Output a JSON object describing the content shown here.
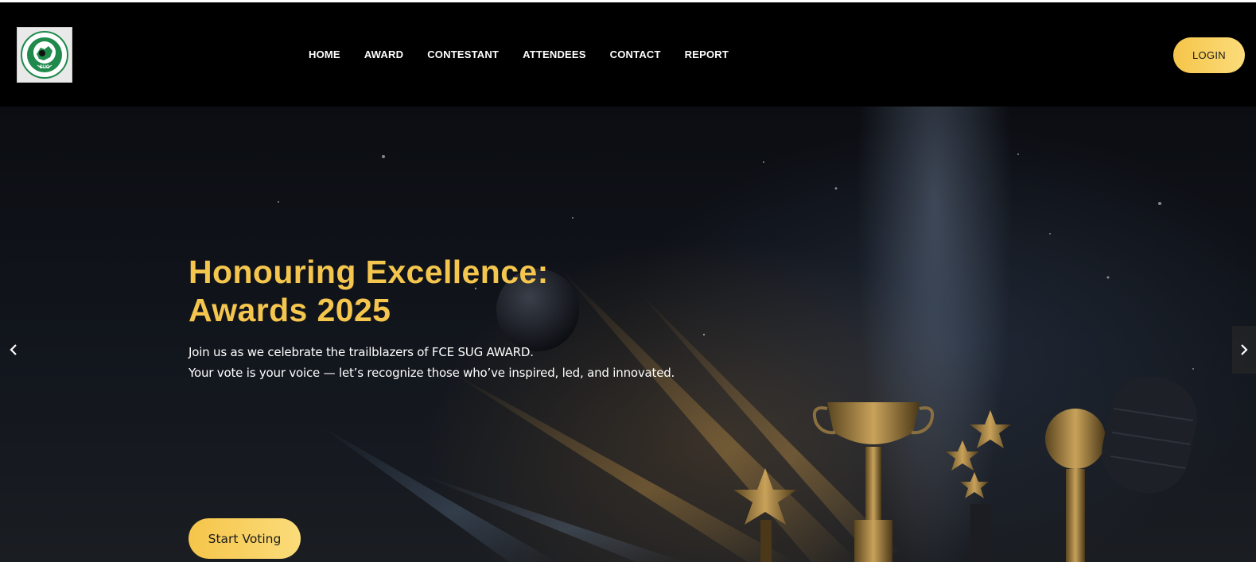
{
  "brand": {
    "logo_text": "SUG",
    "logo_ring_text": "STUDENTS UNION GOVERNMENT"
  },
  "nav": {
    "items": [
      {
        "label": "HOME"
      },
      {
        "label": "AWARD"
      },
      {
        "label": "CONTESTANT"
      },
      {
        "label": "ATTENDEES"
      },
      {
        "label": "CONTACT"
      },
      {
        "label": "REPORT"
      }
    ],
    "login_label": "LOGIN"
  },
  "hero": {
    "title_line1": "Honouring Excellence:",
    "title_line2": "Awards 2025",
    "desc_line1": "Join us as we celebrate the trailblazers of FCE SUG AWARD.",
    "desc_line2": "Your vote is your voice — let’s recognize those who’ve inspired, led, and innovated.",
    "cta_label": "Start Voting"
  },
  "icons": {
    "prev": "chevron-left-icon",
    "next": "chevron-right-icon"
  },
  "colors": {
    "accent": "#f5c64d",
    "button_gradient_start": "#f6c54a",
    "button_gradient_end": "#fbdc7a",
    "nav_background": "#000000",
    "logo_green": "#1f8a4c"
  }
}
